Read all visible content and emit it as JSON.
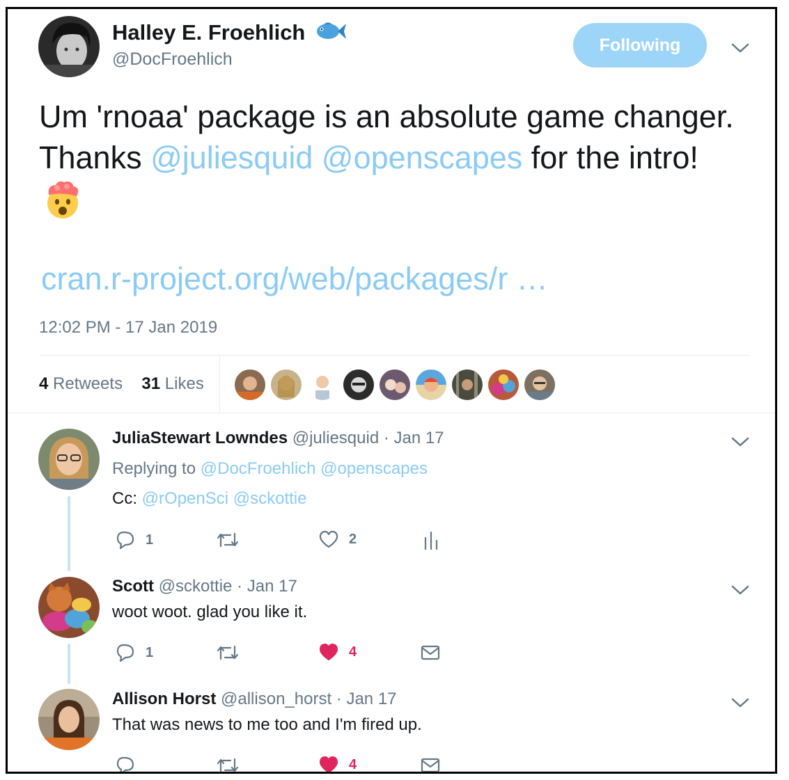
{
  "tweet": {
    "author_name": "Halley E. Froehlich",
    "author_emoji": "fish-emoji",
    "author_handle": "@DocFroehlich",
    "follow_label": "Following",
    "text_part1": "Um 'rnoaa' package is an absolute game changer. Thanks ",
    "mention1": "@juliesquid",
    "mention2": "@openscapes",
    "text_part2": " for the intro! ",
    "text_emoji": "exploding-head-emoji",
    "link": "cran.r-project.org/web/packages/r …",
    "timestamp": "12:02 PM - 17 Jan 2019",
    "retweets_count": "4",
    "retweets_label": "Retweets",
    "likes_count": "31",
    "likes_label": "Likes"
  },
  "colors": {
    "link_blue": "#8bcbf5",
    "follow_bg": "#9dd5f8",
    "like_red": "#e0245e",
    "secondary_text": "#657786",
    "thread_line": "#c4e4f7"
  },
  "replies": [
    {
      "name": "JuliaStewart Lowndes",
      "handle": "@juliesquid",
      "date": "· Jan 17",
      "replying_prefix": "Replying to ",
      "replying_1": "@DocFroehlich",
      "replying_2": "@openscapes",
      "cc_prefix": "Cc: ",
      "cc_1": "@rOpenSci",
      "cc_2": "@sckottie",
      "reply_count": "1",
      "like_count": "2",
      "liked": false,
      "last_icon": "analytics-icon"
    },
    {
      "name": "Scott",
      "handle": "@sckottie",
      "date": "· Jan 17",
      "text": "woot woot. glad you like it.",
      "reply_count": "1",
      "like_count": "4",
      "liked": true,
      "last_icon": "envelope-icon"
    },
    {
      "name": "Allison Horst",
      "handle": "@allison_horst",
      "date": "· Jan 17",
      "text": "That was news to me too and I'm fired up.",
      "like_count": "4",
      "liked": true,
      "last_icon": "envelope-icon"
    }
  ]
}
